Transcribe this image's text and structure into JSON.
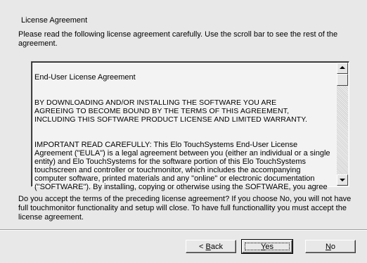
{
  "dialog": {
    "title": "License Agreement",
    "instructions": "Please read the following license agreement carefully. Use the scroll bar to see the rest of the agreement."
  },
  "eula": {
    "heading": "End-User License Agreement",
    "para1": "BY DOWNLOADING AND/OR INSTALLING THE SOFTWARE YOU ARE\nAGREEING TO BECOME BOUND BY THE TERMS OF THIS AGREEMENT,\nINCLUDING THIS SOFTWARE PRODUCT LICENSE AND LIMITED WARRANTY.",
    "para2": "IMPORTANT READ CAREFULLY: This Elo TouchSystems End-User License\nAgreement (\"EULA\") is a legal agreement between you (either an individual or a single\nentity) and Elo TouchSystems for the software portion of this Elo TouchSystems\ntouchscreen and controller or touchmonitor, which includes the accompanying\ncomputer software, printed materials and any \"online\" or electronic documentation\n(\"SOFTWARE\"). By installing, copying or otherwise using the SOFTWARE, you agree"
  },
  "question": "Do you accept the terms of the preceding license agreement? If you choose No, you will not have full touchmonitor functionality and setup will close. To have full functionallity you must accept the license agreement.",
  "buttons": {
    "back_prefix": "< ",
    "back_mnemonic": "B",
    "back_rest": "ack",
    "yes_mnemonic": "Y",
    "yes_rest": "es",
    "no_mnemonic": "N",
    "no_rest": "o"
  }
}
